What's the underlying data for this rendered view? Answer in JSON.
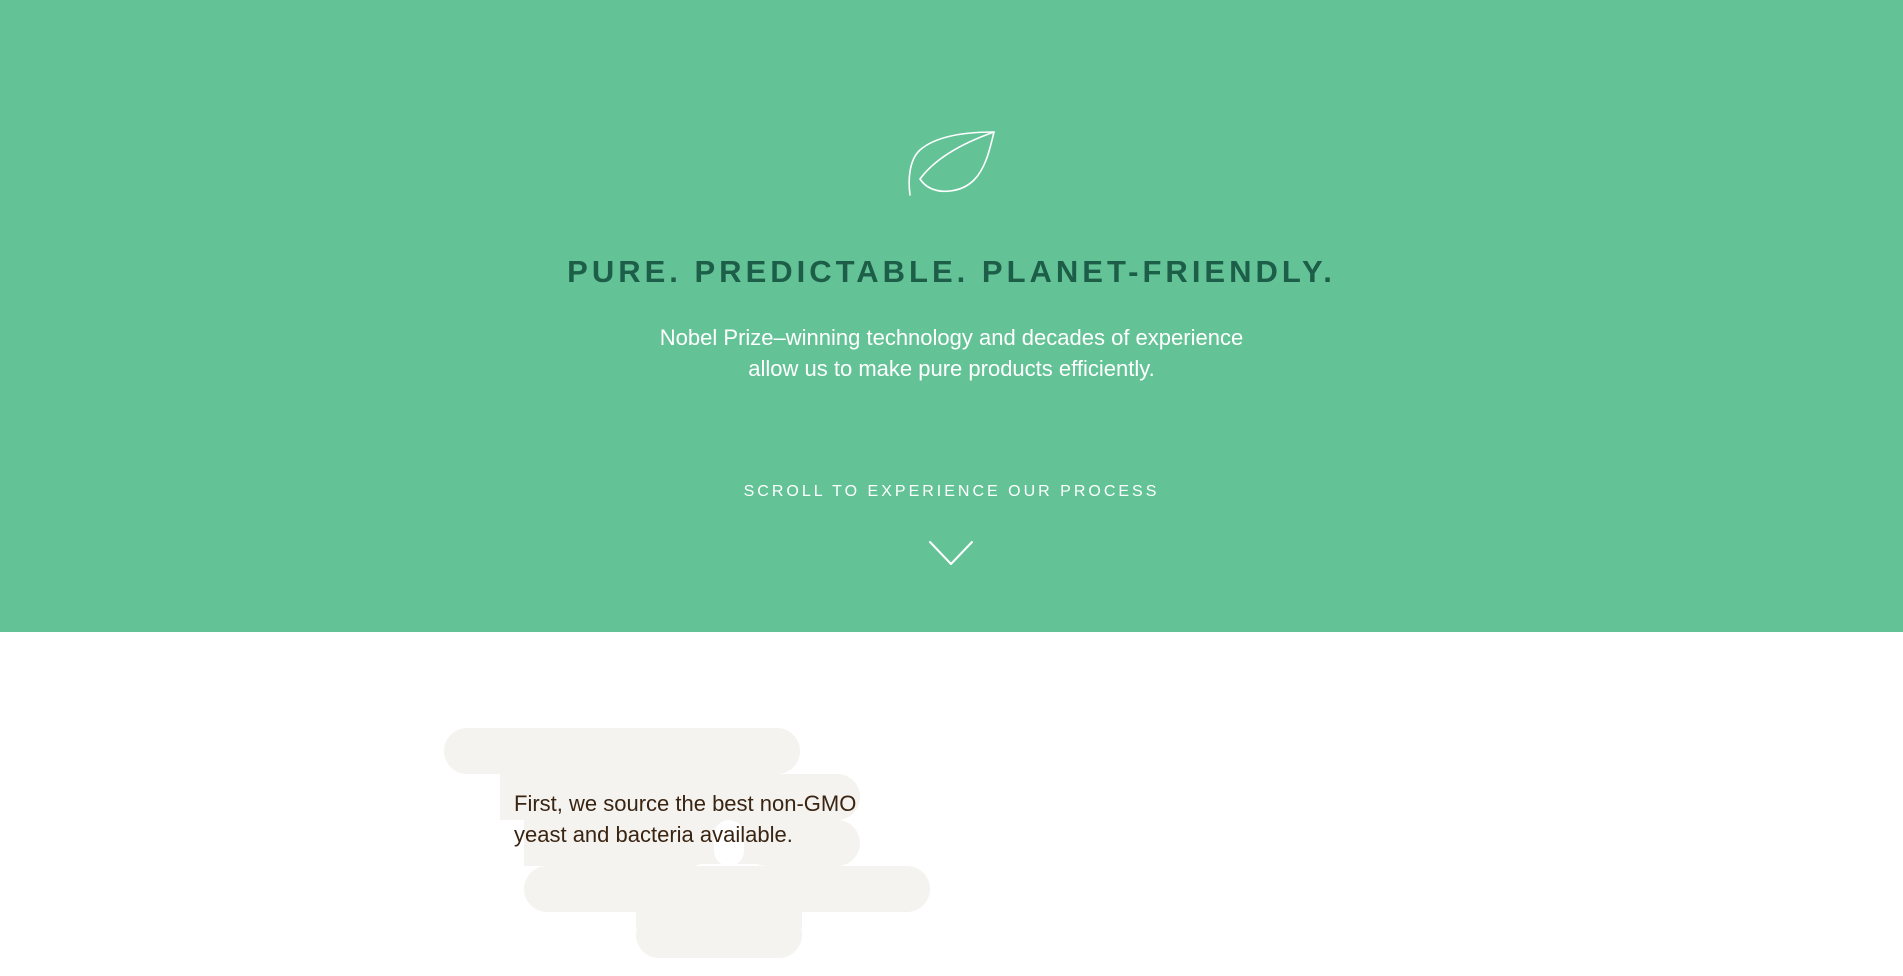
{
  "hero": {
    "icon": "leaf-icon",
    "headline": "PURE. PREDICTABLE. PLANET-FRIENDLY.",
    "subtext_line1": "Nobel Prize–winning technology and decades of experience",
    "subtext_line2": "allow us to make pure products efficiently.",
    "scroll_cta": "SCROLL TO EXPERIENCE OUR PROCESS",
    "scroll_icon": "chevron-down-icon",
    "background_color": "#64c396",
    "headline_color": "#1c5e48"
  },
  "process": {
    "step1_line1": "First, we source the best non-GMO",
    "step1_line2": "yeast and bacteria available.",
    "blob_color": "#f5f3ef",
    "text_color": "#3a2412"
  }
}
